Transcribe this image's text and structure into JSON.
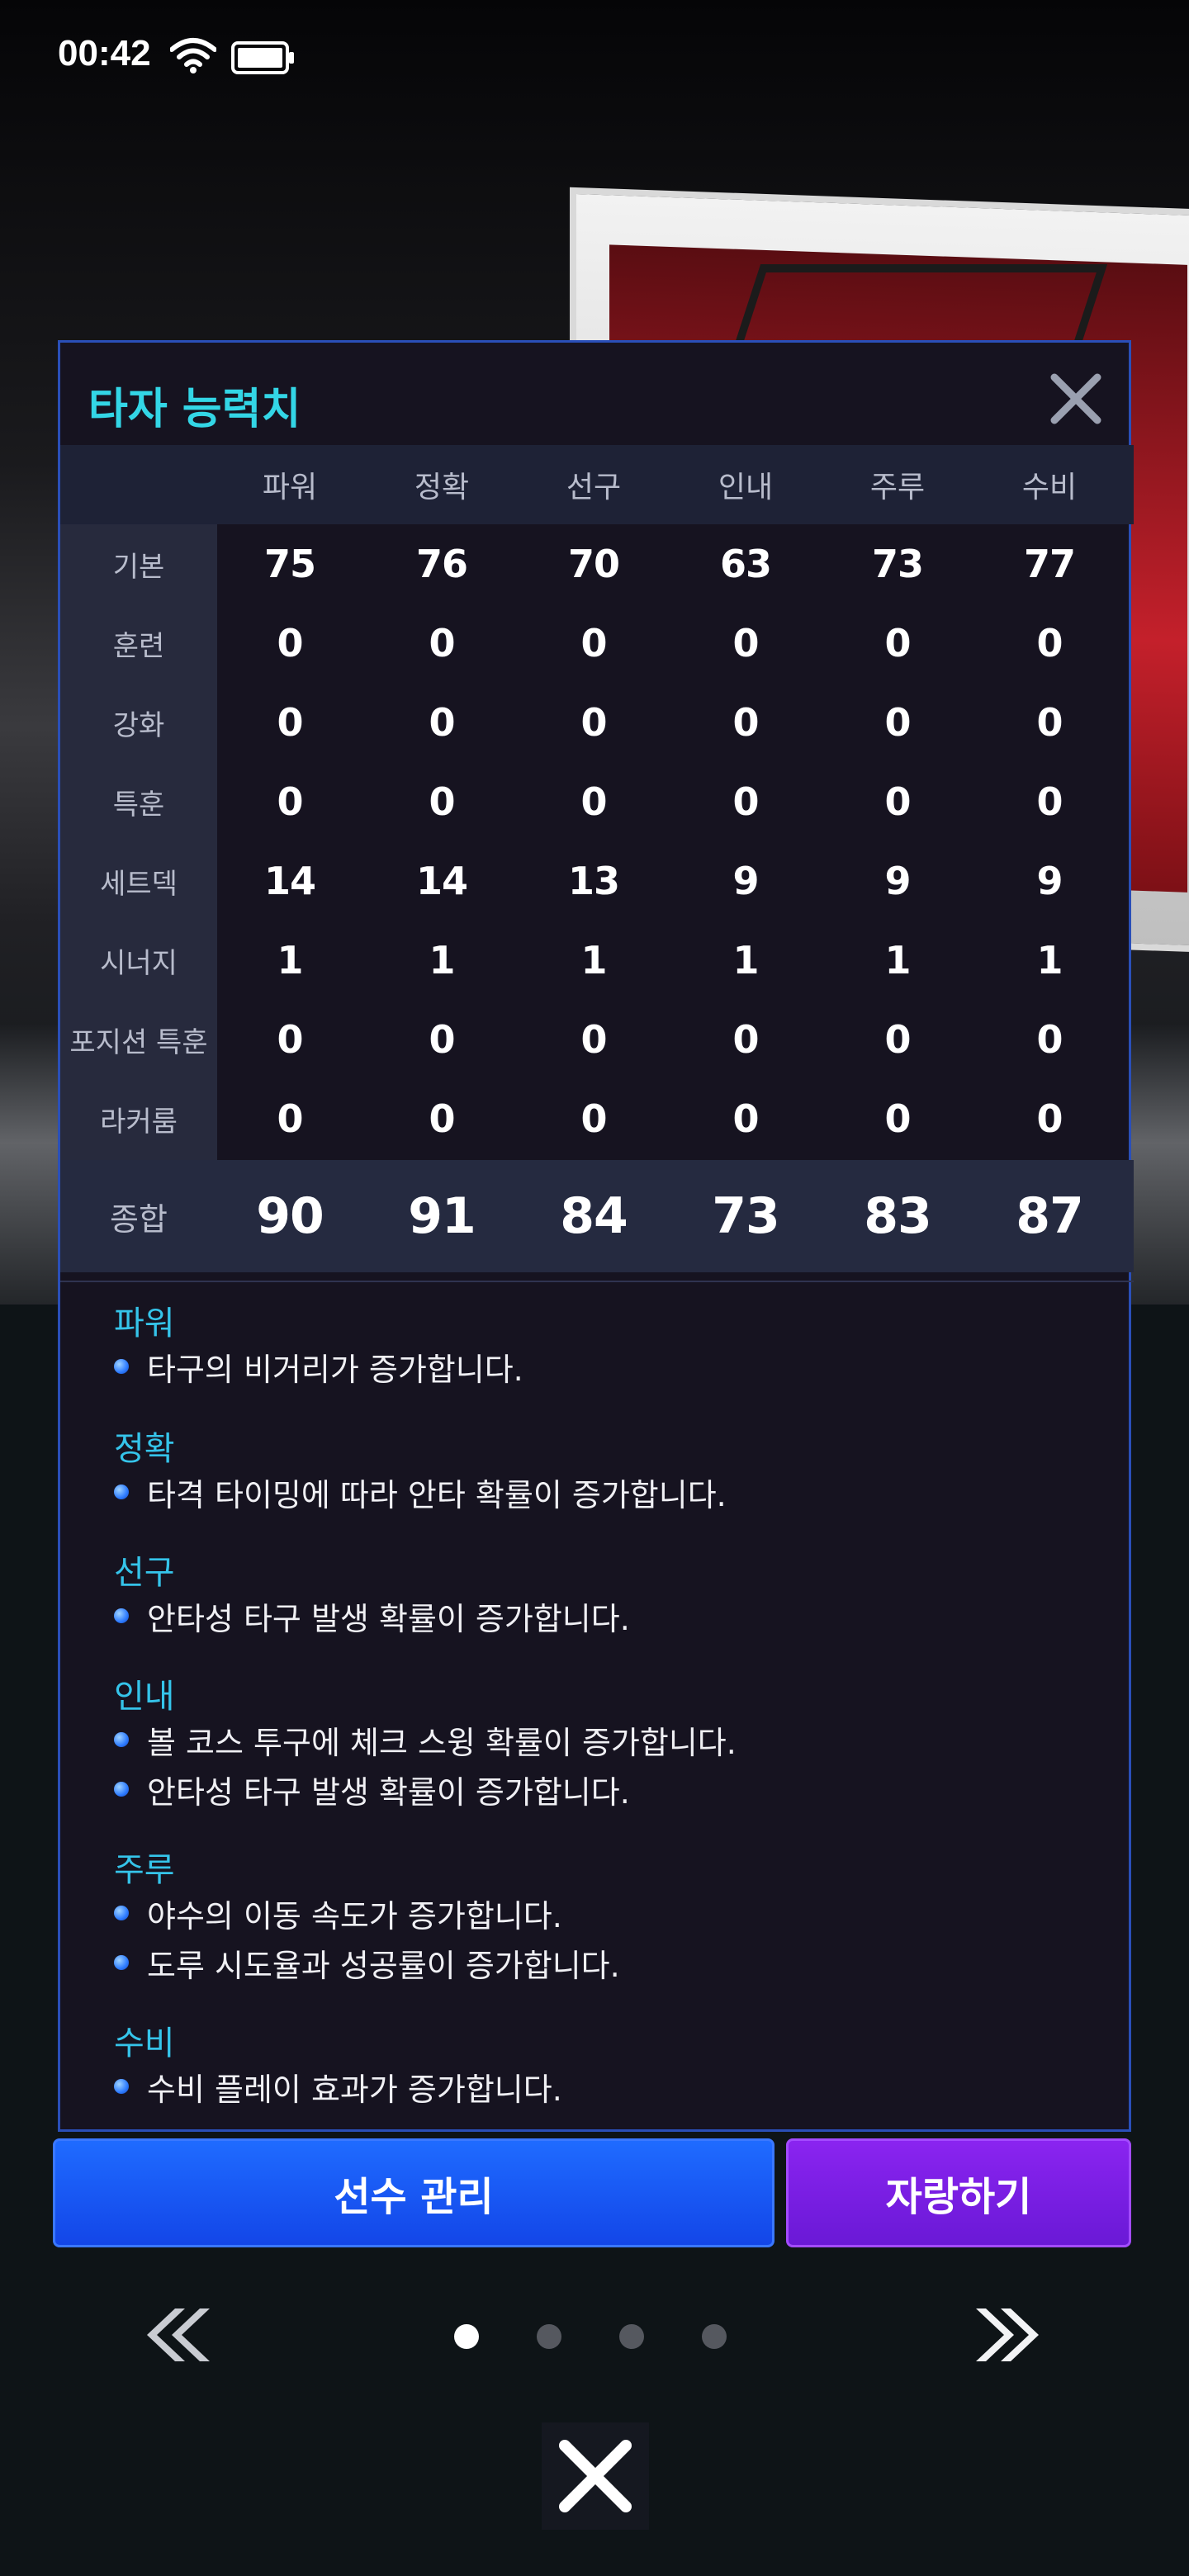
{
  "status_bar": {
    "time": "00:42"
  },
  "modal": {
    "title": "타자 능력치",
    "columns": [
      "파워",
      "정확",
      "선구",
      "인내",
      "주루",
      "수비"
    ],
    "rows": [
      {
        "label": "기본",
        "values": [
          "75",
          "76",
          "70",
          "63",
          "73",
          "77"
        ]
      },
      {
        "label": "훈련",
        "values": [
          "0",
          "0",
          "0",
          "0",
          "0",
          "0"
        ]
      },
      {
        "label": "강화",
        "values": [
          "0",
          "0",
          "0",
          "0",
          "0",
          "0"
        ]
      },
      {
        "label": "특훈",
        "values": [
          "0",
          "0",
          "0",
          "0",
          "0",
          "0"
        ]
      },
      {
        "label": "세트덱",
        "values": [
          "14",
          "14",
          "13",
          "9",
          "9",
          "9"
        ]
      },
      {
        "label": "시너지",
        "values": [
          "1",
          "1",
          "1",
          "1",
          "1",
          "1"
        ]
      },
      {
        "label": "포지션 특훈",
        "values": [
          "0",
          "0",
          "0",
          "0",
          "0",
          "0"
        ]
      },
      {
        "label": "라커룸",
        "values": [
          "0",
          "0",
          "0",
          "0",
          "0",
          "0"
        ]
      }
    ],
    "total": {
      "label": "종합",
      "values": [
        "90",
        "91",
        "84",
        "73",
        "83",
        "87"
      ]
    },
    "descriptions": [
      {
        "title": "파워",
        "lines": [
          "타구의 비거리가 증가합니다."
        ]
      },
      {
        "title": "정확",
        "lines": [
          "타격 타이밍에 따라 안타 확률이 증가합니다."
        ]
      },
      {
        "title": "선구",
        "lines": [
          "안타성 타구 발생 확률이 증가합니다."
        ]
      },
      {
        "title": "인내",
        "lines": [
          "볼 코스 투구에 체크 스윙 확률이 증가합니다.",
          "안타성 타구 발생 확률이 증가합니다."
        ]
      },
      {
        "title": "주루",
        "lines": [
          "야수의 이동 속도가 증가합니다.",
          "도루 시도율과 성공률이 증가합니다."
        ]
      },
      {
        "title": "수비",
        "lines": [
          "수비 플레이 효과가 증가합니다."
        ]
      }
    ]
  },
  "buttons": {
    "manage": "선수 관리",
    "share": "자랑하기"
  },
  "pager": {
    "page_count": 4,
    "active_page": 1
  },
  "colors": {
    "title": "#33d6e6",
    "desc_title": "#35c4ea",
    "manage_button": "#1f6bff",
    "share_button": "#8a24f0"
  },
  "icons": [
    "wifi-icon",
    "battery-icon",
    "close-icon",
    "bullet-icon",
    "double-chevron-left-icon",
    "double-chevron-right-icon"
  ]
}
